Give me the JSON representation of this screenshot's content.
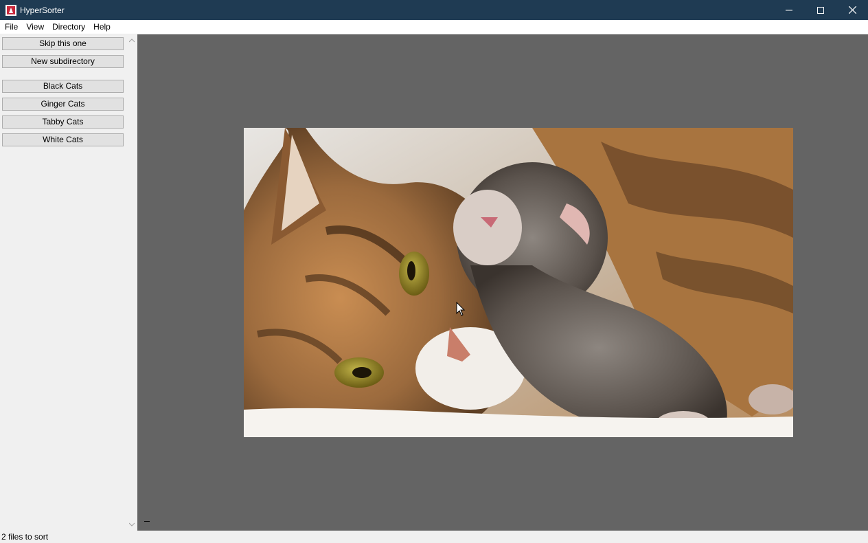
{
  "window": {
    "title": "HyperSorter",
    "app_icon": "app-logo-icon",
    "controls": [
      "minimize-icon",
      "maximize-icon",
      "close-icon"
    ]
  },
  "menu": {
    "items": [
      "File",
      "View",
      "Directory",
      "Help"
    ]
  },
  "sidebar": {
    "skip_label": "Skip this one",
    "new_subdir_label": "New subdirectory",
    "directories": [
      "Black Cats",
      "Ginger Cats",
      "Tabby Cats",
      "White Cats"
    ]
  },
  "viewer": {
    "background": "#646464",
    "image_alt": "photo of a tabby cat with a kitten"
  },
  "status": {
    "text": "2 files to sort"
  }
}
